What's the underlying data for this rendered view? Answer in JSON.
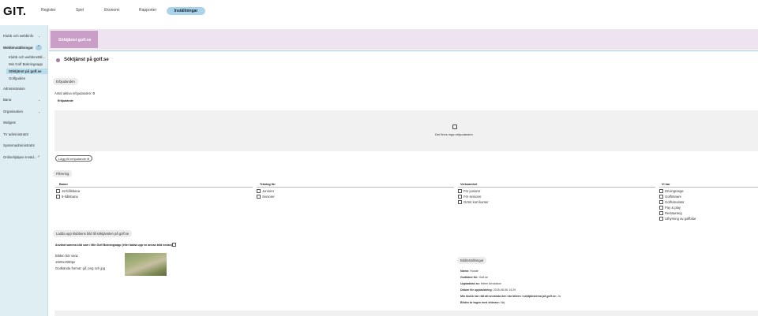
{
  "app": {
    "logo": "GIT."
  },
  "topnav": {
    "items": [
      "Register",
      "Spel",
      "Ekonomi",
      "Rapporter"
    ],
    "active": "Inställningar"
  },
  "sidebar": {
    "klubb": "Klubb och webbinfo",
    "webb": "Webbinställningar",
    "sub": [
      "Klubb och webbinställ...",
      "Min Golf Bokningsapp",
      "Söktjänst på golf.se",
      "Golfguiden"
    ],
    "administration": "Administration",
    "bana": "Bana",
    "organisation": "Organisation",
    "widgets": "Widgets",
    "tv": "TV administratör",
    "sysadmin": "Systemadministratör",
    "onlinehjalpen": "Onlinehjälpen Inväd..."
  },
  "header": {
    "band_title": "Söktjänst golf.se",
    "title": "Söktjänst på golf.se"
  },
  "erbjudanden": {
    "section": "Erbjudanden",
    "count_label": "Antal aktiva erbjudanden:",
    "count": "0",
    "table_header": "Erbjudande",
    "empty": "Det finns inga erbjudanden",
    "add": "Lägg till erbjudande"
  },
  "filtrering": {
    "section": "Filtrering",
    "cols": [
      {
        "title": "Banor",
        "items": [
          "18-hålsbana",
          "9-hålsbana"
        ]
      },
      {
        "title": "Träning för",
        "items": [
          "Juniorer",
          "Seniorer"
        ]
      },
      {
        "title": "Verksamhet",
        "items": [
          "För juniorer",
          "För seniorer",
          "Grönt kort-kurser"
        ]
      },
      {
        "title": "Vi har",
        "items": [
          "Drivingrange",
          "Golftränare",
          "Golfsimulator",
          "Pay & play",
          "Restaurang",
          "Uthyrning av golfbilar"
        ]
      }
    ]
  },
  "upload": {
    "section": "Ladda upp klubbens bild till söktjänsten på golf.se",
    "use_same": "Använd samma bild som i Min Golf Bokningsapp (eller ladda upp en annan bild nedan)",
    "size1": "Bilden bör vara:",
    "size2": "1920x1080px",
    "formats": "Godkända format: gif, png och jpg",
    "settings": "Bildinställningar",
    "meta": [
      {
        "k": "Namn:",
        "v": "Hunde"
      },
      {
        "k": "Godkänd för:",
        "v": "Golf.se"
      },
      {
        "k": "Uppladdad av:",
        "v": "Helen Arnoldson"
      },
      {
        "k": "Datum för uppladdning:",
        "v": "2025-08-06 14:29"
      },
      {
        "k": "Min klubb har rätt att använda den här bilden i söktjänsterna på golf.se:",
        "v": "Ja"
      },
      {
        "k": "Bilden är tagen med drönare:",
        "v": "Nej"
      }
    ]
  }
}
